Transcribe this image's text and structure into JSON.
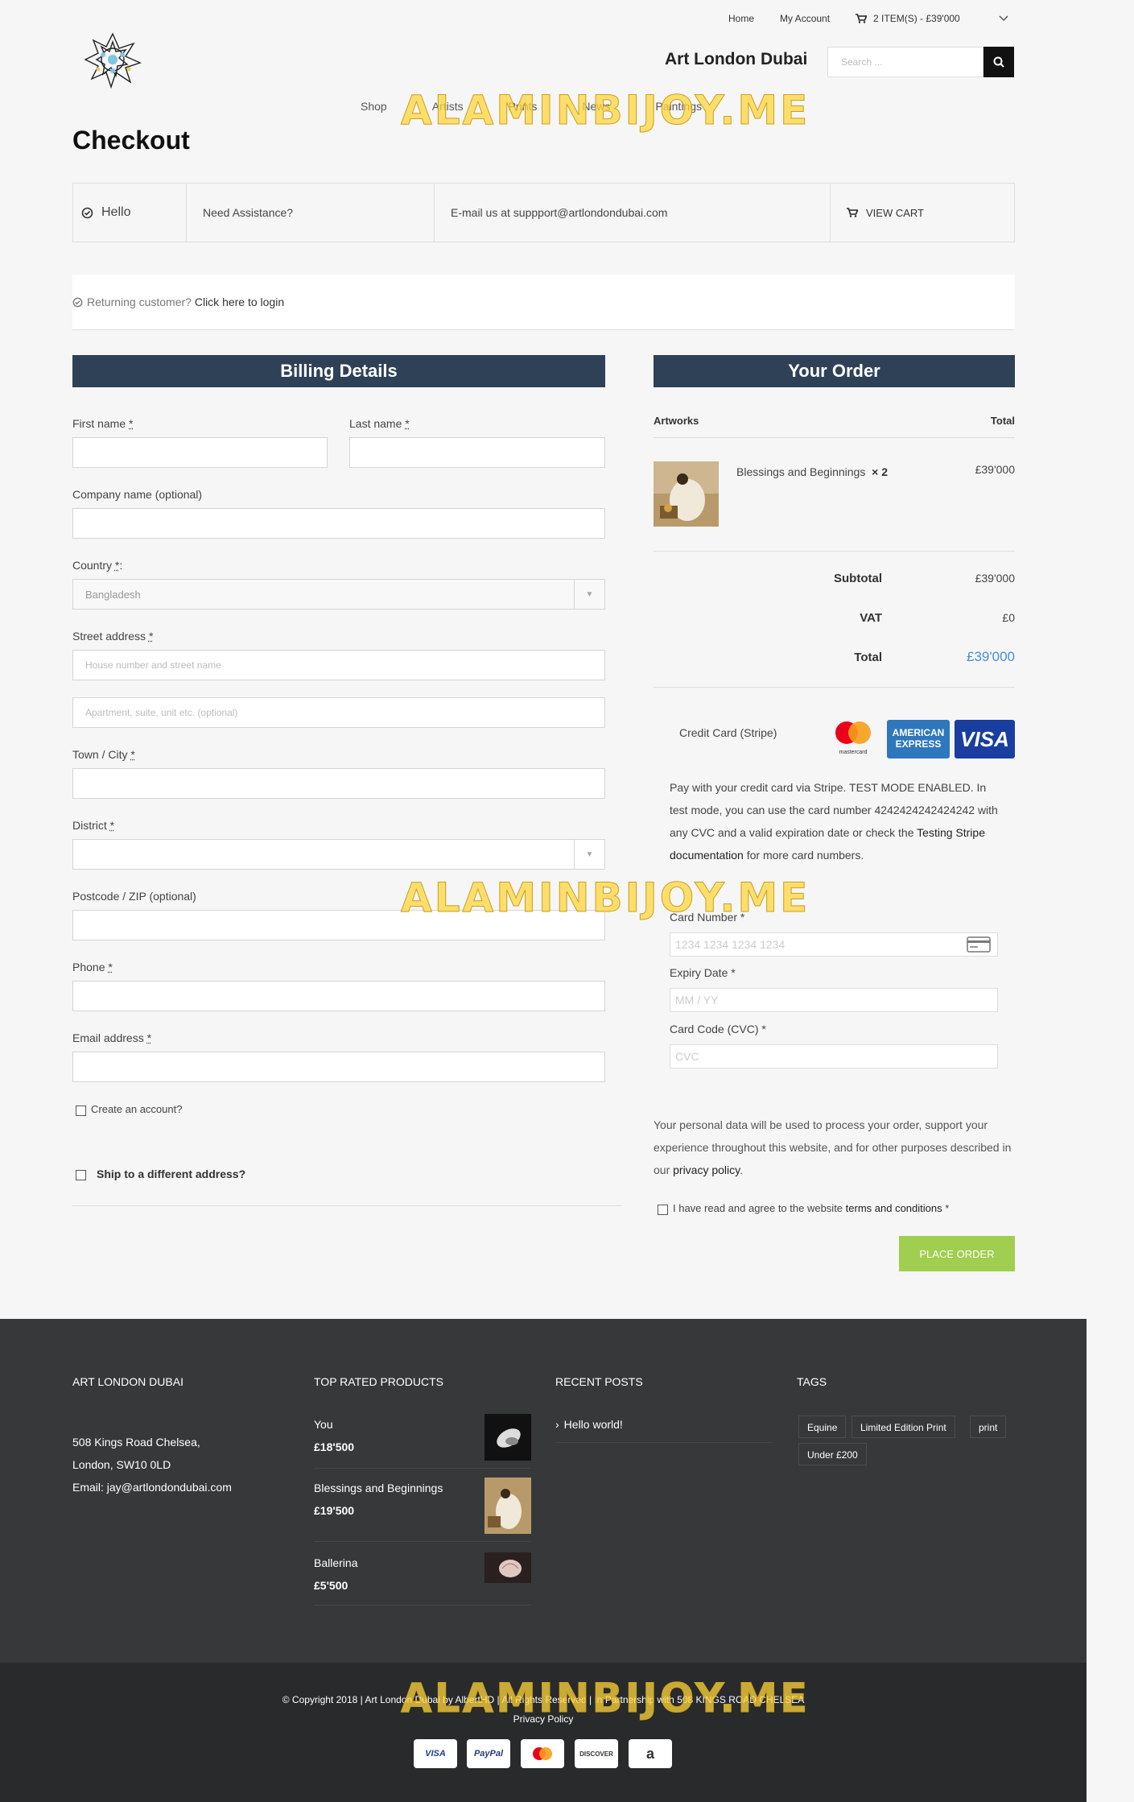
{
  "header": {
    "links": [
      "Home",
      "My Account"
    ],
    "cart_label": "2 ITEM(S) - £39'000",
    "brand": "Art London Dubai",
    "search_placeholder": "Search ...",
    "nav": [
      "Shop",
      "Artists",
      "Prints",
      "News",
      "Paintings"
    ]
  },
  "page_title": "Checkout",
  "info_bar": {
    "hello": "Hello",
    "assistance": "Need Assistance?",
    "email": "E-mail us at suppport@artlondondubai.com",
    "view_cart": "VIEW CART"
  },
  "login": {
    "prompt": "Returning customer?",
    "link": "Click here to login"
  },
  "billing": {
    "title": "Billing Details",
    "first_name": "First name",
    "last_name": "Last name",
    "company": "Company name (optional)",
    "country": "Country",
    "country_value": "Bangladesh",
    "street": "Street address",
    "street_ph1": "House number and street name",
    "street_ph2": "Apartment, suite, unit etc. (optional)",
    "town": "Town / City",
    "district": "District",
    "postcode": "Postcode / ZIP (optional)",
    "phone": "Phone",
    "email": "Email address",
    "create_account": "Create an account?",
    "ship_different": "Ship to a different address?"
  },
  "order": {
    "title": "Your Order",
    "col_artworks": "Artworks",
    "col_total": "Total",
    "item_name": "Blessings and Beginnings",
    "item_qty": "× 2",
    "item_total": "£39'000",
    "subtotal_label": "Subtotal",
    "subtotal": "£39'000",
    "vat_label": "VAT",
    "vat": "£0",
    "total_label": "Total",
    "total": "£39'000"
  },
  "payment": {
    "method": "Credit Card (Stripe)",
    "card_logos": {
      "mastercard": "mastercard",
      "amex": "AMERICAN EXPRESS",
      "visa": "VISA"
    },
    "description_1": "Pay with your credit card via Stripe. TEST MODE ENABLED. In test mode, you can use the card number 4242424242424242 with any CVC and a valid expiration date or check the ",
    "description_link": "Testing Stripe documentation",
    "description_2": " for more card numbers.",
    "card_number_label": "Card Number *",
    "card_number_ph": "1234 1234 1234 1234",
    "expiry_label": "Expiry Date *",
    "expiry_ph": "MM / YY",
    "cvc_label": "Card Code (CVC) *",
    "cvc_ph": "CVC",
    "privacy_1": "Your personal data will be used to process your order, support your experience throughout this website, and for other purposes described in our ",
    "privacy_link": "privacy policy",
    "privacy_2": ".",
    "terms_1": "I have read and agree to the website ",
    "terms_link": "terms and conditions",
    "terms_2": " *",
    "place_order": "PLACE ORDER"
  },
  "footer": {
    "col1_title": "ART LONDON DUBAI",
    "address_1": "508 Kings Road Chelsea,",
    "address_2": "London, SW10 0LD",
    "email": "Email: jay@artlondondubai.com",
    "col2_title": "TOP RATED PRODUCTS",
    "products": [
      {
        "name": "You",
        "price": "£18'500"
      },
      {
        "name": "Blessings and Beginnings",
        "price": "£19'500"
      },
      {
        "name": "Ballerina",
        "price": "£5'500"
      }
    ],
    "col3_title": "RECENT POSTS",
    "post": "Hello world!",
    "col4_title": "TAGS",
    "tags": [
      "Equine",
      "Limited Edition Print",
      "print",
      "Under £200"
    ],
    "copyright": "© Copyright 2018   |   Art London Dubai by AlbertHD   |   All Rights Reserved   |   In Partnership with 508 KINGS ROAD CHELSEA",
    "privacy": "Privacy Policy",
    "pay_icons": [
      "VISA",
      "PayPal",
      "mastercard",
      "DISCOVER",
      "a"
    ]
  },
  "watermark": "ALAMINBIJOY.ME"
}
